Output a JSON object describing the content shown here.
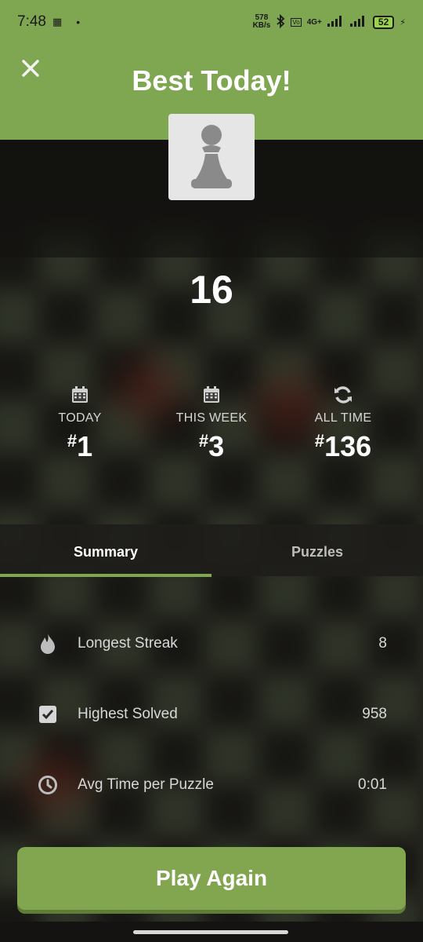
{
  "status_bar": {
    "time": "7:48",
    "network_speed": "578",
    "network_speed_unit": "KB/s",
    "network_type": "4G+",
    "battery": "52"
  },
  "header": {
    "title": "Best Today!"
  },
  "score": "16",
  "ranks": [
    {
      "icon": "calendar-icon",
      "label": "TODAY",
      "prefix": "#",
      "value": "1"
    },
    {
      "icon": "calendar-icon",
      "label": "THIS WEEK",
      "prefix": "#",
      "value": "3"
    },
    {
      "icon": "refresh-icon",
      "label": "ALL TIME",
      "prefix": "#",
      "value": "136"
    }
  ],
  "tabs": [
    {
      "label": "Summary",
      "active": true
    },
    {
      "label": "Puzzles",
      "active": false
    }
  ],
  "stats": [
    {
      "icon": "flame-icon",
      "label": "Longest Streak",
      "value": "8"
    },
    {
      "icon": "checkbox-icon",
      "label": "Highest Solved",
      "value": "958"
    },
    {
      "icon": "clock-icon",
      "label": "Avg Time per Puzzle",
      "value": "0:01"
    }
  ],
  "play_button": "Play Again",
  "colors": {
    "accent": "#7fa650",
    "background": "#161512"
  }
}
